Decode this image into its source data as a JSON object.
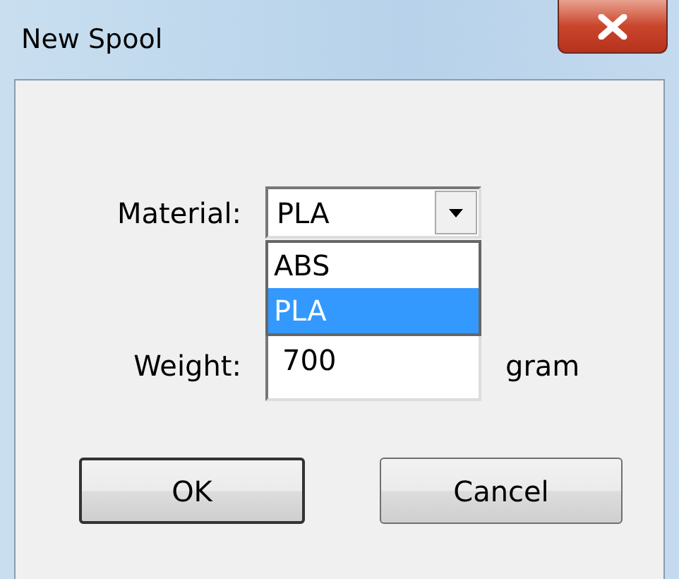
{
  "window": {
    "title": "New Spool"
  },
  "material": {
    "label": "Material:",
    "value": "PLA",
    "expanded": true,
    "options": [
      {
        "label": "ABS",
        "selected": false
      },
      {
        "label": "PLA",
        "selected": true
      }
    ]
  },
  "weight": {
    "label": "Weight:",
    "value": "700",
    "unit": "gram"
  },
  "buttons": [
    "OK",
    "Cancel"
  ]
}
